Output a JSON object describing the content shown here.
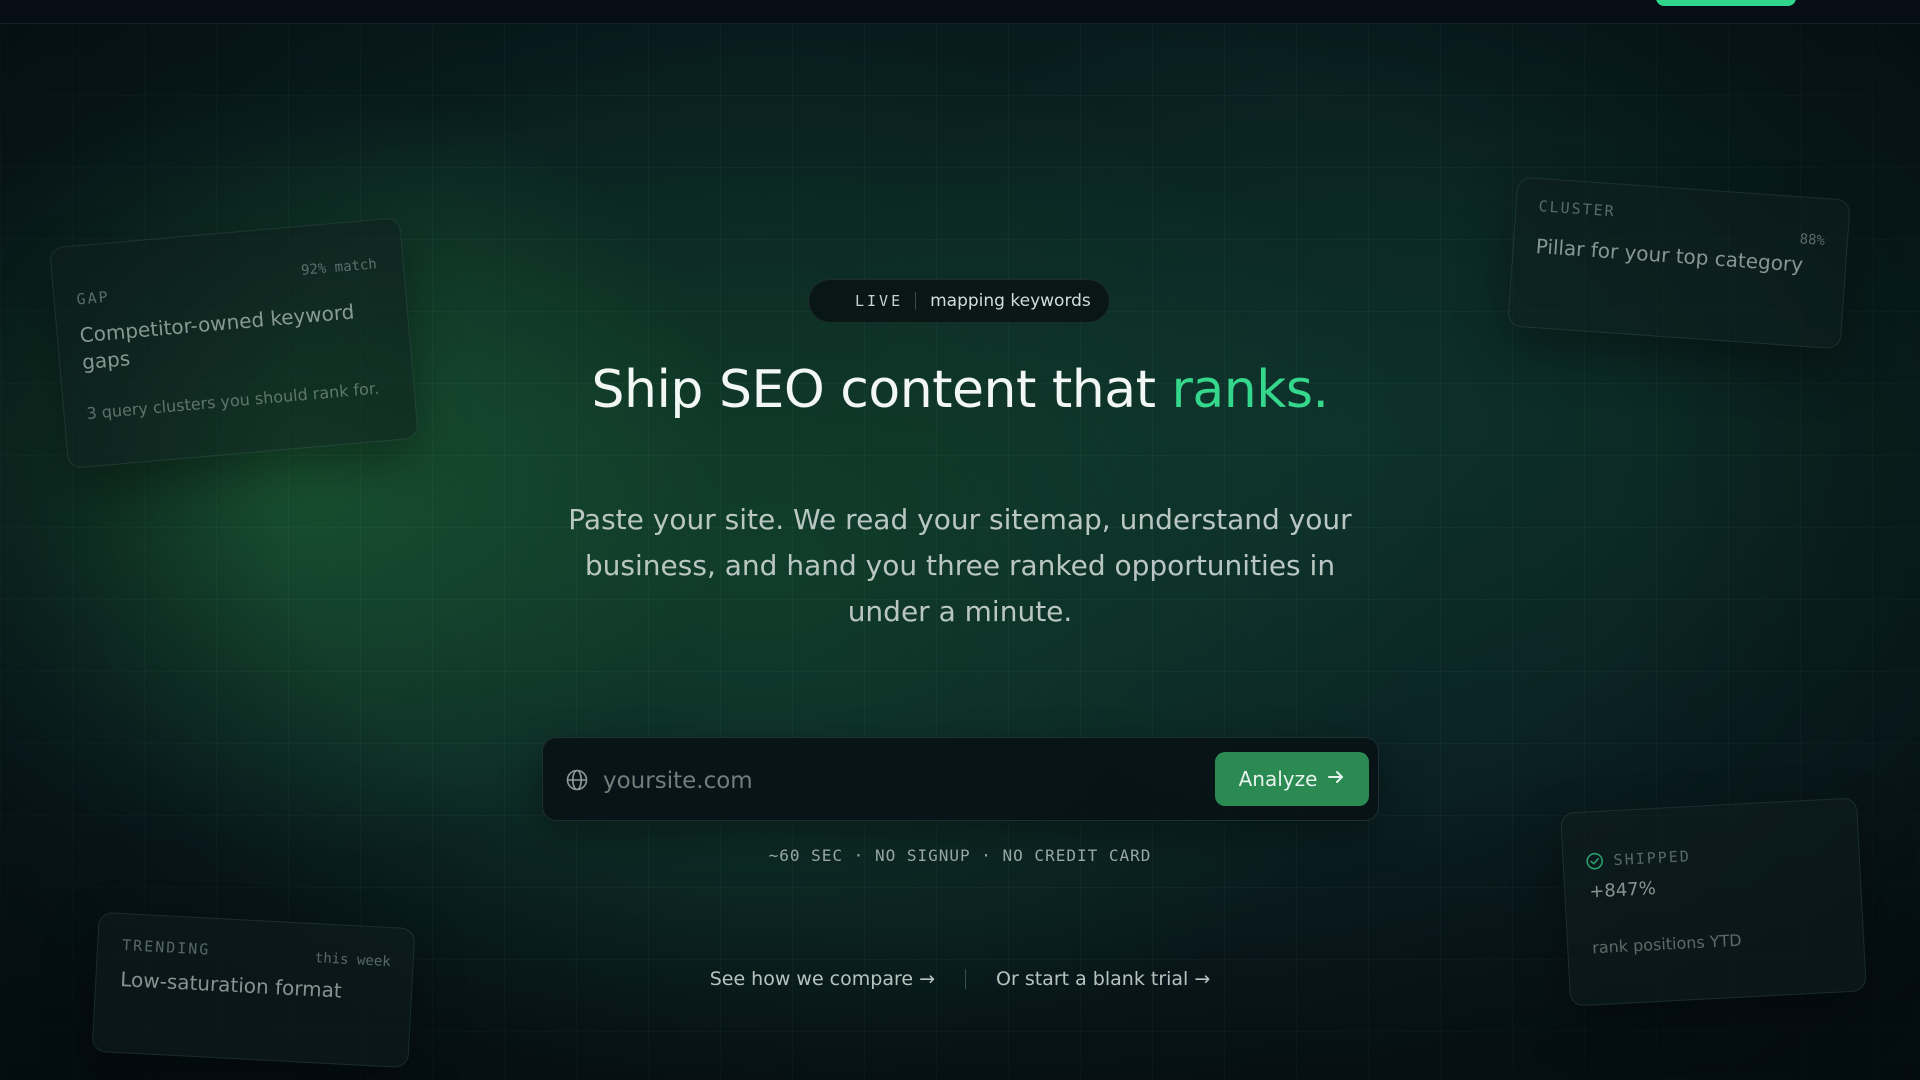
{
  "colors": {
    "accent": "#34d78c",
    "button": "#2a8a52",
    "background": "#0b2520"
  },
  "hero": {
    "live_label": "LIVE",
    "live_status": "mapping keywords",
    "headline_main": "Ship SEO content that ",
    "headline_accent": "ranks.",
    "subheadline": "Paste your site. We read your sitemap, understand your business, and hand you three ranked opportunities in under a minute.",
    "fineprint": "~60 SEC · NO SIGNUP · NO CREDIT CARD"
  },
  "search": {
    "placeholder": "yoursite.com",
    "value": "",
    "icon": "globe-icon",
    "button_label": "Analyze",
    "button_icon": "arrow-right-icon"
  },
  "links": {
    "compare": "See how we compare →",
    "blank_trial": "Or start a blank trial →"
  },
  "cards": {
    "gap": {
      "tag": "GAP",
      "meta": "92% match",
      "title": "Competitor-owned keyword gaps",
      "sub": "3 query clusters you should rank for."
    },
    "cluster": {
      "tag": "CLUSTER",
      "meta": "88%",
      "title": "Pillar for your top category"
    },
    "trending": {
      "tag": "TRENDING",
      "meta": "this week",
      "title": "Low-saturation format"
    },
    "shipped": {
      "tag": "SHIPPED",
      "value": "+847%",
      "sub": "rank positions YTD"
    }
  }
}
